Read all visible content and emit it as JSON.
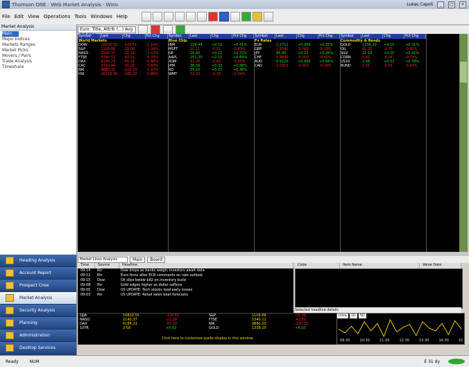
{
  "window": {
    "title": "Thomson ONE · Web Market Analysis · Wino",
    "user": "Lukas Capoli"
  },
  "menu": [
    "File",
    "Edit",
    "View",
    "Operations",
    "Tools",
    "Windows",
    "Help"
  ],
  "sidebar": {
    "header": "Market Analysis",
    "items": [
      "Main",
      "Major Indices",
      "Markets Ranges",
      "Market Picks",
      "Movers / Pairs",
      "Trade Analysis",
      "Timeshare"
    ],
    "nav": [
      "Heading Analysis",
      "Account Report",
      "Prospect Crew",
      "Market Analysis",
      "Security Analysis",
      "Planning",
      "Administration",
      "Desktop Services"
    ]
  },
  "grid": {
    "combo": "Euro: Title, Attrib (...) Avg Pct Chg",
    "columns": [
      "Symbol",
      "Last",
      "Chg",
      "Pct Chg"
    ],
    "groups": [
      {
        "name": "World Markets",
        "rows": [
          [
            "DOW",
            "10820.55",
            "-124.61",
            "-1.14%",
            "r"
          ],
          [
            "S&P",
            "1109.88",
            "-15.08",
            "-1.34%",
            "r"
          ],
          [
            "NASD",
            "2140.37",
            "-22.18",
            "-1.02%",
            "r"
          ],
          [
            "FTSE",
            "5340.11",
            "-42.51",
            "-0.79%",
            "r"
          ],
          [
            "DAX",
            "6184.23",
            "-55.10",
            "-0.88%",
            "r"
          ],
          [
            "CAC",
            "3710.44",
            "-31.20",
            "-0.83%",
            "r"
          ],
          [
            "NIK",
            "9880.20",
            "-110.33",
            "-1.10%",
            "r"
          ],
          [
            "HSI",
            "20120.50",
            "-180.20",
            "-0.89%",
            "r"
          ]
        ]
      },
      {
        "name": "Blue Chip",
        "rows": [
          [
            "IBM",
            "128.44",
            "+0.52",
            "+0.41%",
            "g"
          ],
          [
            "MSFT",
            "25.11",
            "-0.21",
            "-0.83%",
            "r"
          ],
          [
            "GE",
            "16.80",
            "+0.12",
            "+0.72%",
            "g"
          ],
          [
            "AAPL",
            "251.20",
            "+2.10",
            "+0.84%",
            "g"
          ],
          [
            "XOM",
            "61.20",
            "-0.40",
            "-0.65%",
            "r"
          ],
          [
            "JPM",
            "38.50",
            "+0.33",
            "+0.86%",
            "g"
          ],
          [
            "KO",
            "55.10",
            "+0.21",
            "+0.38%",
            "g"
          ],
          [
            "WMT",
            "53.20",
            "-0.18",
            "-0.34%",
            "r"
          ]
        ]
      },
      {
        "name": "Fx Rates",
        "rows": [
          [
            "EUR",
            "1.2712",
            "+0.004",
            "+0.31%",
            "g"
          ],
          [
            "GBP",
            "1.5540",
            "-0.002",
            "-0.13%",
            "r"
          ],
          [
            "JPY",
            "85.40",
            "+0.22",
            "+0.26%",
            "g"
          ],
          [
            "CHF",
            "0.9840",
            "-0.003",
            "-0.30%",
            "r"
          ],
          [
            "AUD",
            "0.9120",
            "+0.006",
            "+0.66%",
            "g"
          ],
          [
            "CAD",
            "1.0310",
            "-0.002",
            "-0.19%",
            "r"
          ]
        ]
      },
      {
        "name": "Commodity & Bonds",
        "rows": [
          [
            "GOLD",
            "1338.20",
            "+4.10",
            "+0.31%",
            "g"
          ],
          [
            "OIL",
            "81.25",
            "-0.75",
            "-0.91%",
            "r"
          ],
          [
            "SILV",
            "22.10",
            "+0.20",
            "+0.91%",
            "g"
          ],
          [
            "CORN",
            "5.42",
            "-0.04",
            "-0.73%",
            "r"
          ],
          [
            "US10",
            "2.58",
            "+0.02",
            "+0.78%",
            "g"
          ],
          [
            "BUND",
            "2.31",
            "-0.01",
            "-0.43%",
            "r"
          ]
        ]
      }
    ]
  },
  "news": {
    "tabs": [
      "Main",
      "Board"
    ],
    "combo": "Market Lines Analysis",
    "headers": [
      "Time",
      "Source",
      "Headline"
    ],
    "rows": [
      [
        "09:14",
        "Rtr",
        "Dow drops as banks weigh; investors await data"
      ],
      [
        "09:12",
        "Rtr",
        "Euro firms after ECB comments on rate outlook"
      ],
      [
        "09:10",
        "Dow",
        "Oil slips below $82 on inventory build"
      ],
      [
        "09:08",
        "Rtr",
        "Gold edges higher as dollar softens"
      ],
      [
        "09:05",
        "Dow",
        "US UPDATE: Tech stocks lead early losses"
      ],
      [
        "09:03",
        "Rtr",
        "US UPDATE: Retail sales beat forecasts"
      ]
    ],
    "detail_headers": [
      "Code",
      "Item Name",
      "Value Date"
    ],
    "detail_foot": "Selected headline details"
  },
  "ticker": {
    "rows": [
      [
        "DJIA",
        "10820.55",
        "-124.61",
        "S&P",
        "1109.88",
        "-15.08"
      ],
      [
        "NASD",
        "2140.37",
        "-22.18",
        "FTSE",
        "5340.11",
        "-42.51"
      ],
      [
        "DAX",
        "6184.23",
        "-55.10",
        "NIK",
        "9880.20",
        "-110.33"
      ],
      [
        "10YR",
        "2.58",
        "+0.02",
        "GOLD",
        "1338.20",
        "+4.10"
      ]
    ],
    "message": "Click here to customize quote display in this window"
  },
  "chart_mini": {
    "tabs": [
      "Intra",
      "1D",
      "5D"
    ],
    "x": [
      "09:30",
      "10:30",
      "11:30",
      "12:30",
      "13:30",
      "14:30",
      "15:30"
    ],
    "values": [
      52,
      48,
      55,
      47,
      60,
      50,
      58,
      44,
      62,
      49,
      54,
      57,
      45,
      60,
      53,
      50,
      58,
      46,
      61,
      52
    ]
  },
  "status": {
    "left": "Ready",
    "mid": "NUM",
    "right": "E 31 dy"
  }
}
